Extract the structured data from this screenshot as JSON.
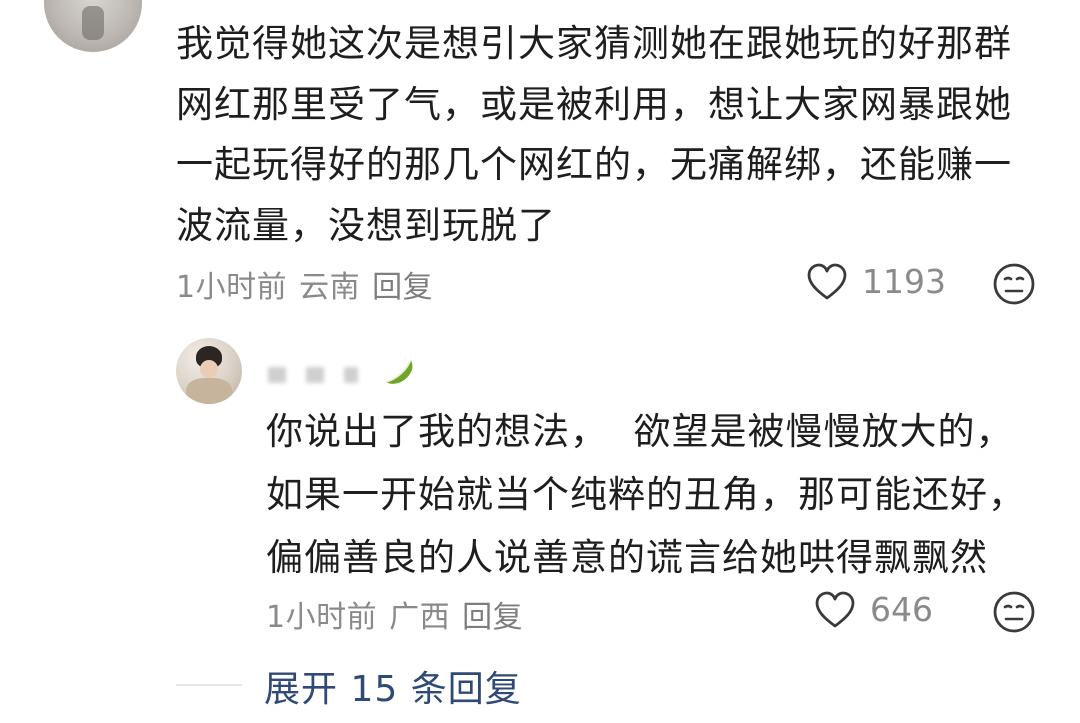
{
  "comment": {
    "lines": [
      "我觉得她这次是想引大家猜测她在跟她玩的好那群",
      "网红那里受了气，或是被利用，想让大家网暴跟她",
      "一起玩得好的那几个网红的，无痛解绑，还能赚一",
      "波流量，没想到玩脱了"
    ],
    "time": "1小时前",
    "location": "云南",
    "reply_label": "回复",
    "likes": "1193",
    "icons": {
      "like": "heart-icon",
      "dislike": "meh-face-icon"
    }
  },
  "sub_reply": {
    "lines": [
      "你说出了我的想法，  欲望是被慢慢放大的，",
      "如果一开始就当个纯粹的丑角，那可能还好，",
      "偏偏善良的人说善意的谎言给她哄得飘飘然"
    ],
    "time": "1小时前",
    "location": "广西",
    "reply_label": "回复",
    "likes": "646",
    "icons": {
      "like": "heart-icon",
      "dislike": "meh-face-icon",
      "badge": "leaf-badge-icon"
    }
  },
  "expand_replies": "展开 15 条回复",
  "colors": {
    "text": "#1e1e1e",
    "meta": "#8a8a8a",
    "link": "#304a78",
    "badge": "#6ea52a"
  }
}
